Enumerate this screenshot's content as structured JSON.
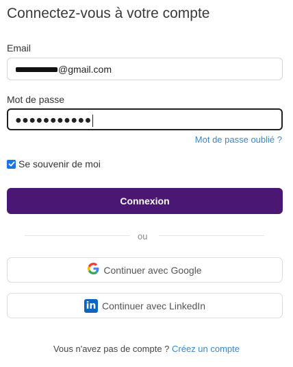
{
  "header": {
    "title": "Connectez-vous à votre compte"
  },
  "form": {
    "email_label": "Email",
    "email_value": "@gmail.com",
    "password_label": "Mot de passe",
    "password_value": "●●●●●●●●●●●",
    "forgot_link": "Mot de passe oublié ?",
    "remember_label": "Se souvenir de moi",
    "remember_checked": true,
    "submit_label": "Connexion"
  },
  "divider": {
    "label": "ou"
  },
  "social": {
    "google_label": "Continuer avec Google",
    "linkedin_label": "Continuer avec LinkedIn",
    "linkedin_icon_text": "in"
  },
  "footer": {
    "text": "Vous n'avez pas de compte ? ",
    "link": "Créez un compte"
  },
  "colors": {
    "primary": "#4a1772",
    "link": "#3a86c8",
    "checkbox": "#1a73e8",
    "linkedin": "#0a66c2"
  },
  "icons": {
    "google": "google-icon",
    "linkedin": "linkedin-icon",
    "checkbox": "checkmark-icon"
  }
}
